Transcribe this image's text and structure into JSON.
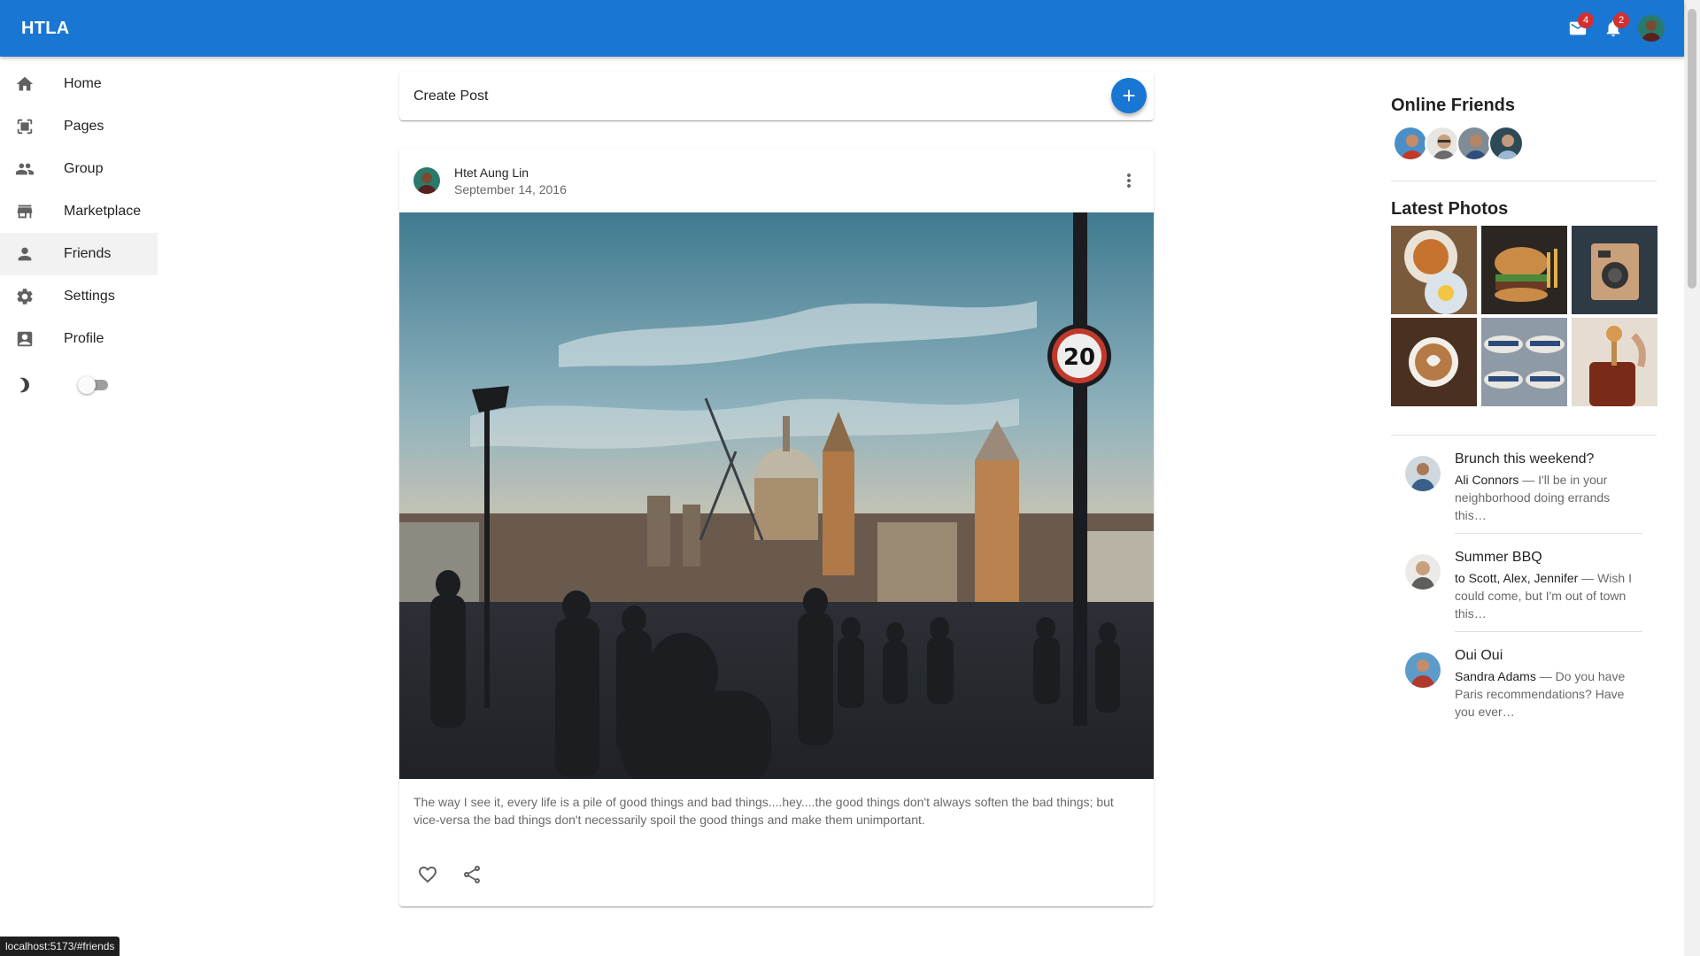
{
  "app": {
    "title": "HTLA",
    "notifications": {
      "mail_count": "4",
      "bell_count": "2"
    },
    "accent": "#1976d2",
    "badge_color": "#d32f2f"
  },
  "sidebar": {
    "items": [
      {
        "label": "Home",
        "icon": "home-icon"
      },
      {
        "label": "Pages",
        "icon": "pages-icon"
      },
      {
        "label": "Group",
        "icon": "group-icon"
      },
      {
        "label": "Marketplace",
        "icon": "store-icon"
      },
      {
        "label": "Friends",
        "icon": "person-icon",
        "active": true
      },
      {
        "label": "Settings",
        "icon": "gear-icon"
      },
      {
        "label": "Profile",
        "icon": "profile-icon"
      }
    ],
    "dark_mode_on": false
  },
  "feed": {
    "create_post_label": "Create Post",
    "post": {
      "author": "Htet Aung Lin",
      "date": "September 14, 2016",
      "text": "The way I see it, every life is a pile of good things and bad things....hey....the good things don't always soften the bad things; but vice-versa the bad things don't necessarily spoil the good things and make them unimportant."
    }
  },
  "rightbar": {
    "online_friends_title": "Online Friends",
    "online_friends_count": 4,
    "latest_photos_title": "Latest Photos",
    "photos": [
      "food-plate-photo",
      "burger-photo",
      "camera-photo",
      "latte-photo",
      "hats-photo",
      "honey-jar-photo"
    ],
    "messages": [
      {
        "title": "Brunch this weekend?",
        "who": "Ali Connors",
        "text": " — I'll be in your neighborhood doing errands this…"
      },
      {
        "title": "Summer BBQ",
        "who": "to Scott, Alex, Jennifer",
        "text": " — Wish I could come, but I'm out of town this…"
      },
      {
        "title": "Oui Oui",
        "who": "Sandra Adams",
        "text": " — Do you have Paris recommendations? Have you ever…"
      }
    ]
  },
  "status_bar": {
    "url": "localhost:5173/#friends"
  }
}
